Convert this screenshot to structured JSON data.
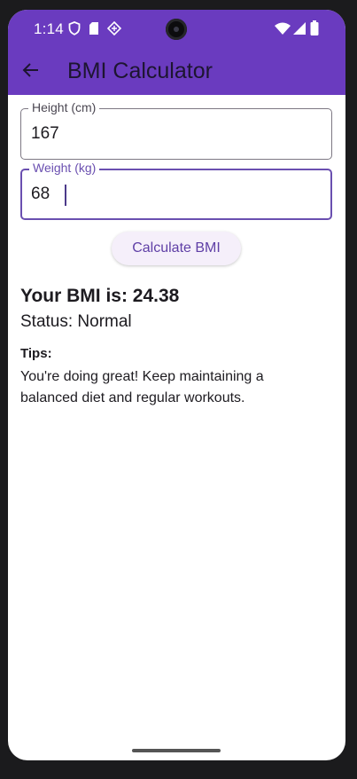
{
  "status_bar": {
    "time": "1:14",
    "icons_left": [
      "shield-icon",
      "sd-card-icon",
      "sync-icon"
    ],
    "icons_right": [
      "wifi-icon",
      "signal-icon",
      "battery-icon"
    ]
  },
  "app_bar": {
    "title": "BMI Calculator",
    "back_icon": "arrow-back-icon",
    "color": "#6a3bbf"
  },
  "form": {
    "height": {
      "label": "Height (cm)",
      "value": "167"
    },
    "weight": {
      "label": "Weight (kg)",
      "value": "68",
      "focused": true
    },
    "calculate_label": "Calculate BMI"
  },
  "result": {
    "bmi_text": "Your BMI is: 24.38",
    "status_text": "Status: Normal",
    "tips_label": "Tips:",
    "tips_text": "You're doing great! Keep maintaining a balanced diet and regular workouts."
  },
  "colors": {
    "accent": "#6a4fb0",
    "button_bg": "#f5effa"
  }
}
